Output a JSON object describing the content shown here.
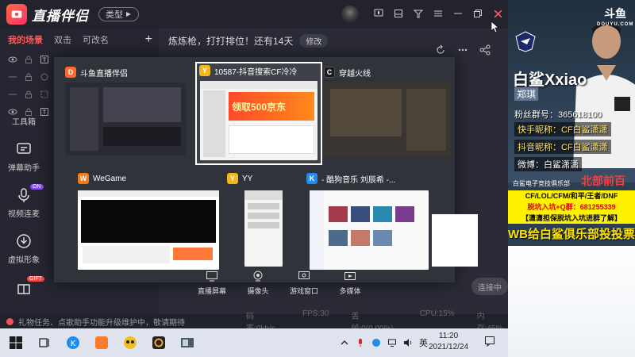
{
  "app": {
    "title": "直播伴侣",
    "type_label": "类型",
    "colors": {
      "accent": "#ff5a5a",
      "bg": "#22232d",
      "taskbar": "#dfe4ee"
    }
  },
  "sidebar": {
    "scene_tabs": [
      {
        "label": "我的场景",
        "active": true
      },
      {
        "label": "双击",
        "active": false
      },
      {
        "label": "可改名",
        "active": false
      }
    ],
    "add_label": "+",
    "tools": [
      {
        "label": "工具箱",
        "icon": "toolbox-icon"
      },
      {
        "label": "弹幕助手",
        "icon": "danmaku-icon"
      },
      {
        "label": "视频连麦",
        "icon": "video-link-icon",
        "badge": "ON"
      },
      {
        "label": "虚拟形象",
        "icon": "avatar-icon"
      }
    ],
    "gift_badge": "GIFT"
  },
  "main": {
    "notice": "炼炼枪，打打排位！还有14天",
    "edit_label": "修改"
  },
  "switcher": {
    "windows": [
      {
        "title": "斗鱼直播伴侣",
        "icon_color": "#ff6a2a",
        "icon_letter": "D"
      },
      {
        "title": "10587-抖音搜索CF冷冷",
        "icon_color": "#f0b81a",
        "icon_letter": "Y",
        "selected": true,
        "banner": "领取500京东"
      },
      {
        "title": "穿越火线",
        "icon_color": "#1a1a1a",
        "icon_letter": "C"
      },
      {
        "title": "WeGame",
        "icon_color": "#f07b1a",
        "icon_letter": "W"
      },
      {
        "title": "YY",
        "icon_color": "#f0b81a",
        "icon_letter": "Y"
      },
      {
        "title": "- 酷狗音乐 刘辰希 -...",
        "icon_color": "#1f8cf0",
        "icon_letter": "K"
      }
    ],
    "bottom_tools": [
      {
        "label": "直播屏幕",
        "icon": "screen-icon"
      },
      {
        "label": "摄像头",
        "icon": "camera-icon"
      },
      {
        "label": "游戏窗口",
        "icon": "game-window-icon"
      },
      {
        "label": "多媒体",
        "icon": "media-icon"
      }
    ],
    "live_label": "连接中"
  },
  "status": {
    "message": "礼物任务、点歌助手功能升级维护中，敬请期待",
    "metrics": [
      "码率:0kb/s",
      "FPS:30",
      "丢帧:0(0.00%)",
      "CPU:15%",
      "内存:45%"
    ]
  },
  "taskbar": {
    "tray_lang": "英",
    "time": "11:20",
    "date": "2021/12/24"
  },
  "promo": {
    "logo": "斗鱼",
    "logo_sub": "DOUYU.COM",
    "streamer": "白鲨Xxiao",
    "real_name": "郑琪",
    "fan_group": "粉丝群号：365618100",
    "kuaishou": "快手昵称：CF白鲨潇潇",
    "douyin": "抖音昵称：CF白鲨潇潇",
    "weibo": "微博：白鲨潇潇",
    "club": "白鲨电子竞技俱乐部",
    "region": "北部前百",
    "games": "CF/LOL/CFM/和平/王者/DNF",
    "join": "脱坑入坑+Q群：681255339",
    "guarantee": "【潇潇担保脱坑入坑进群了解】",
    "wb": "WB给白鲨俱乐部投投票"
  }
}
